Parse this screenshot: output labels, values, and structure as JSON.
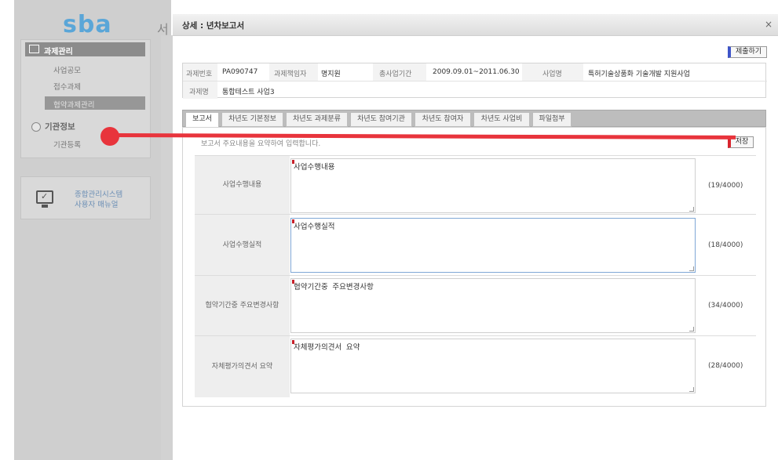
{
  "left": {
    "logo": "sba",
    "title_fragment": "서",
    "menu_header": "과제관리",
    "menu_items": [
      "사업공모",
      "접수과제",
      "협약과제관리"
    ],
    "org_header": "기관정보",
    "org_items": [
      "기관등록"
    ],
    "manual_lines": [
      "종합관리시스템",
      "사용자  매뉴얼"
    ]
  },
  "modal": {
    "title": "상세 : 년차보고서",
    "close": "×",
    "submit_label": "제출하기",
    "info": {
      "project_no_label": "과제번호",
      "project_no": "PA090747",
      "manager_label": "과제책임자",
      "manager": "명지원",
      "period_label": "총사업기간",
      "period": "2009.09.01~2011.06.30",
      "business_label": "사업명",
      "business": "특허기술상품화 기술개발 지원사업",
      "project_name_label": "과제명",
      "project_name": "통합테스트 사업3"
    },
    "tabs": [
      "보고서",
      "차년도 기본정보",
      "차년도 과제분류",
      "차년도 참여기관",
      "차년도 참여자",
      "차년도 사업비",
      "파일첨부"
    ],
    "guide": "보고서 주요내용을 요약하여 입력합니다.",
    "save_label": "저장",
    "rows": [
      {
        "label": "사업수행내용",
        "value": "사업수행내용",
        "count": "(19/4000)"
      },
      {
        "label": "사업수행실적",
        "value": "사업수행실적",
        "count": "(18/4000)"
      },
      {
        "label": "협약기간중 주요변경사항",
        "value": "협약기간중 주요변경사항",
        "count": "(34/4000)"
      },
      {
        "label": "자체평가의견서 요약",
        "value": "자체평가의견서 요약",
        "count": "(28/4000)"
      }
    ]
  },
  "colors": {
    "accent_red": "#e8343c",
    "submit_accent": "#3e54c9",
    "logo": "#5aa6d8"
  }
}
